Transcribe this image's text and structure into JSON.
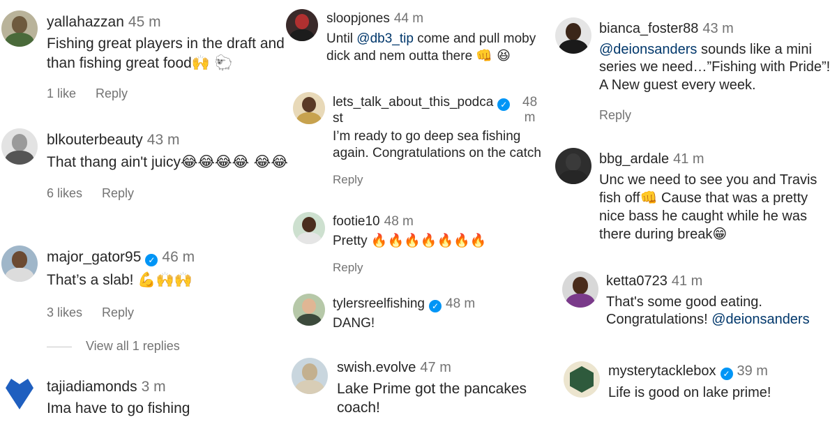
{
  "comments": {
    "yallahazzan": {
      "user": "yallahazzan",
      "time": "45 m",
      "text": "Fishing great players in the draft and than fishing great food",
      "emoji": "🙌 🐑",
      "likes": "1 like",
      "reply": "Reply"
    },
    "blkouterbeauty": {
      "user": "blkouterbeauty",
      "time": "43 m",
      "text": "That thang ain't juicy",
      "emoji": "😂😂😂😂 😂😂",
      "likes": "6 likes",
      "reply": "Reply"
    },
    "major_gator95": {
      "user": "major_gator95",
      "time": "46 m",
      "text": "That’s a slab!",
      "emoji": "💪🙌🙌",
      "likes": "3 likes",
      "reply": "Reply"
    },
    "view_replies": "View all 1 replies",
    "tajiadiamonds": {
      "user": "tajiadiamonds",
      "time": "3 m",
      "text": "Ima have to go fishing"
    },
    "sloopjones": {
      "user": "sloopjones",
      "time": "44 m",
      "text_prefix": "Until ",
      "mention": "@db3_tip",
      "text_suffix": " come and pull moby dick and nem outta there",
      "emoji": "👊 😆"
    },
    "lets_talk": {
      "user_line1": "lets_talk_about_this_podca",
      "user_line2": "st",
      "time_line1": "48",
      "time_line2": "m",
      "text": "I’m ready to go deep sea fishing again. Congratulations on the catch",
      "reply": "Reply"
    },
    "footie10": {
      "user": "footie10",
      "time": "48 m",
      "text": "Pretty",
      "emoji": "🔥🔥🔥🔥🔥🔥🔥",
      "reply": "Reply"
    },
    "tylersreelfishing": {
      "user": "tylersreelfishing",
      "time": "48 m",
      "text": "DANG!"
    },
    "swish_evolve": {
      "user": "swish.evolve",
      "time": "47 m",
      "text": "Lake Prime got the pancakes coach!"
    },
    "bianca_foster88": {
      "user": "bianca_foster88",
      "time": "43 m",
      "mention": "@deionsanders",
      "text_suffix": " sounds like a mini series we need…”Fishing with Pride”! A New guest every week.",
      "reply": "Reply"
    },
    "bbg_ardale": {
      "user": "bbg_ardale",
      "time": "41 m",
      "text_prefix": "Unc we need to see you and Travis fish off",
      "emoji1": "👊",
      "text_suffix": " Cause that was a pretty nice bass he caught while he was there during break",
      "emoji2": "😁"
    },
    "ketta0723": {
      "user": "ketta0723",
      "time": "41 m",
      "text_prefix": "That's some good eating. Congratulations! ",
      "mention": "@deionsanders"
    },
    "mysterytacklebox": {
      "user": "mysterytacklebox",
      "time": "39 m",
      "text": "Life is good on lake prime!"
    }
  },
  "verified_icon": "check-icon",
  "colors": {
    "verified": "#0095f6",
    "mention": "#00376b",
    "muted": "#737373",
    "text": "#262626"
  }
}
